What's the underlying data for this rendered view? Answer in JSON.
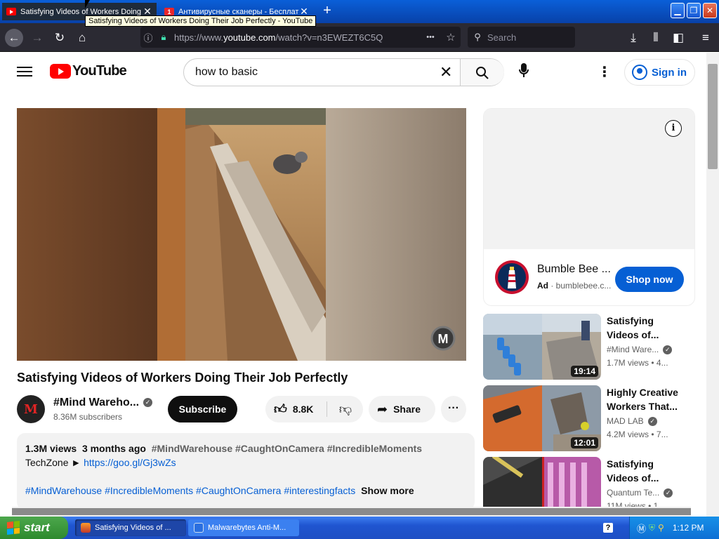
{
  "browser": {
    "tabs": [
      {
        "title": "Satisfying Videos of Workers Doing Their Job Perfectly - YouTube",
        "active": true
      },
      {
        "title": "Антивирусные сканеры - Бесплатно",
        "active": false
      }
    ],
    "tooltip": "Satisfying Videos of Workers Doing Their Job Perfectly - YouTube",
    "url_prefix": "https://www.",
    "url_domain": "youtube.com",
    "url_path": "/watch?v=n3EWEZT6C5Q",
    "search_placeholder": "Search",
    "new_tab": "+",
    "more_glyph": "•••"
  },
  "youtube": {
    "logo_text": "YouTube",
    "search_query": "how to basic",
    "sign_in": "Sign in",
    "video": {
      "title": "Satisfying Videos of Workers Doing Their Job Perfectly",
      "channel": "#Mind Wareho...",
      "channel_initial": "M",
      "subscribers": "8.36M subscribers",
      "subscribe": "Subscribe",
      "likes": "8.8K",
      "share": "Share",
      "watermark": "M"
    },
    "description": {
      "views": "1.3M views",
      "age": "3 months ago",
      "hashtags_top": "#MindWarehouse #CaughtOnCamera #IncredibleMoments",
      "line2_prefix": "TechZone ►",
      "link": "https://goo.gl/Gj3wZs",
      "hashtags_bottom": "#MindWarehouse #IncredibleMoments #CaughtOnCamera #interestingfacts",
      "show_more": "Show more"
    },
    "ad": {
      "name": "Bumble Bee ...",
      "label": "Ad",
      "domain": "bumblebee.c...",
      "cta": "Shop now"
    },
    "recommendations": [
      {
        "title": "Satisfying Videos of...",
        "channel": "#Mind Ware...",
        "verified": true,
        "views": "1.7M views",
        "age": "4...",
        "duration": "19:14"
      },
      {
        "title": "Highly Creative Workers That...",
        "channel": "MAD LAB",
        "verified": true,
        "views": "4.2M views",
        "age": "7...",
        "duration": "12:01"
      },
      {
        "title": "Satisfying Videos of...",
        "channel": "Quantum Te...",
        "verified": true,
        "views": "11M views",
        "age": "1...",
        "duration": ""
      }
    ]
  },
  "taskbar": {
    "start": "start",
    "tasks": [
      {
        "label": "Satisfying Videos of ...",
        "active": true
      },
      {
        "label": "Malwarebytes Anti-M...",
        "active": false
      }
    ],
    "help": "?",
    "clock": "1:12 PM"
  }
}
